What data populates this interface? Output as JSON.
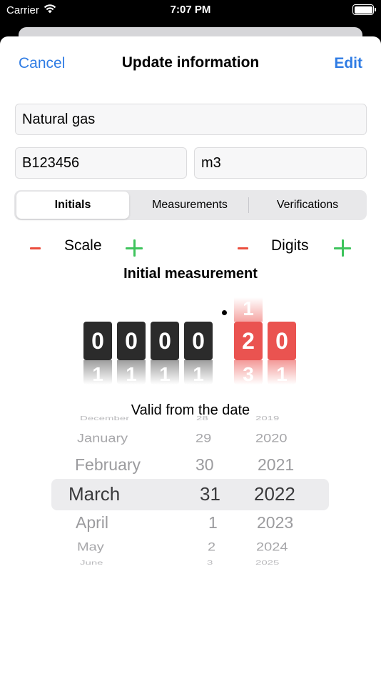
{
  "status_bar": {
    "carrier": "Carrier",
    "time": "7:07 PM",
    "wifi_icon": "wifi-icon",
    "battery_icon": "battery-full-icon"
  },
  "nav": {
    "cancel_label": "Cancel",
    "title": "Update information",
    "edit_label": "Edit"
  },
  "form": {
    "name_value": "Natural gas",
    "serial_value": "B123456",
    "unit_value": "m3"
  },
  "tabs": [
    {
      "label": "Initials",
      "selected": true
    },
    {
      "label": "Measurements",
      "selected": false
    },
    {
      "label": "Verifications",
      "selected": false
    }
  ],
  "steppers": {
    "scale_label": "Scale",
    "digits_label": "Digits",
    "minus_color": "#eb4d3d",
    "plus_color": "#3ec45c"
  },
  "measurement": {
    "title": "Initial measurement",
    "integer_digits": [
      "0",
      "0",
      "0",
      "0"
    ],
    "integer_next": [
      "1",
      "1",
      "1",
      "1"
    ],
    "decimal_digits": [
      "2",
      "0"
    ],
    "decimal_prev": [
      "1"
    ],
    "decimal_next": [
      "3",
      "1"
    ],
    "integer_color": "#2b2b2b",
    "decimal_color": "#ea5350"
  },
  "date_picker": {
    "label": "Valid from the date",
    "months": [
      "December",
      "January",
      "February",
      "March",
      "April",
      "May",
      "June"
    ],
    "days": [
      "28",
      "29",
      "30",
      "31",
      "1",
      "2",
      "3"
    ],
    "years": [
      "2019",
      "2020",
      "2021",
      "2022",
      "2023",
      "2024",
      "2025"
    ],
    "selected_month": "March",
    "selected_day": "31",
    "selected_year": "2022"
  },
  "colors": {
    "accent": "#2f7ce4"
  }
}
